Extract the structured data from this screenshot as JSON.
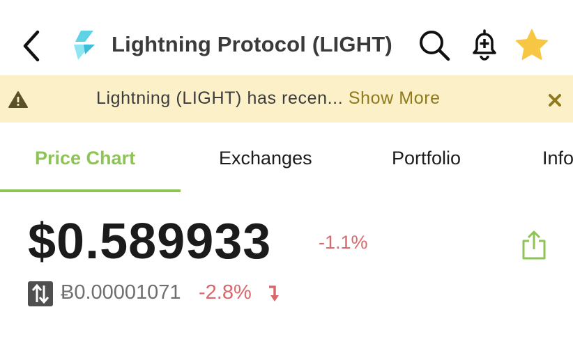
{
  "header": {
    "title": "Lightning Protocol (LIGHT)",
    "icons": [
      "back-arrow-icon",
      "lightning-logo",
      "search-icon",
      "bell-plus-icon",
      "star-icon"
    ]
  },
  "banner": {
    "message": "Lightning (LIGHT) has recen...",
    "link_label": "Show More",
    "icons": [
      "warning-icon",
      "close-icon"
    ]
  },
  "tabs": [
    {
      "label": "Price Chart",
      "active": true
    },
    {
      "label": "Exchanges",
      "active": false
    },
    {
      "label": "Portfolio",
      "active": false
    },
    {
      "label": "Info",
      "active": false
    }
  ],
  "price": {
    "usd": "$0.589933",
    "usd_change": "-1.1%",
    "btc": "Ƀ0.00001071",
    "btc_change": "-2.8%"
  },
  "colors": {
    "accent": "#8dc455",
    "negative": "#d9686c",
    "banner_bg": "#fbf0c8",
    "star": "#f7c744"
  }
}
